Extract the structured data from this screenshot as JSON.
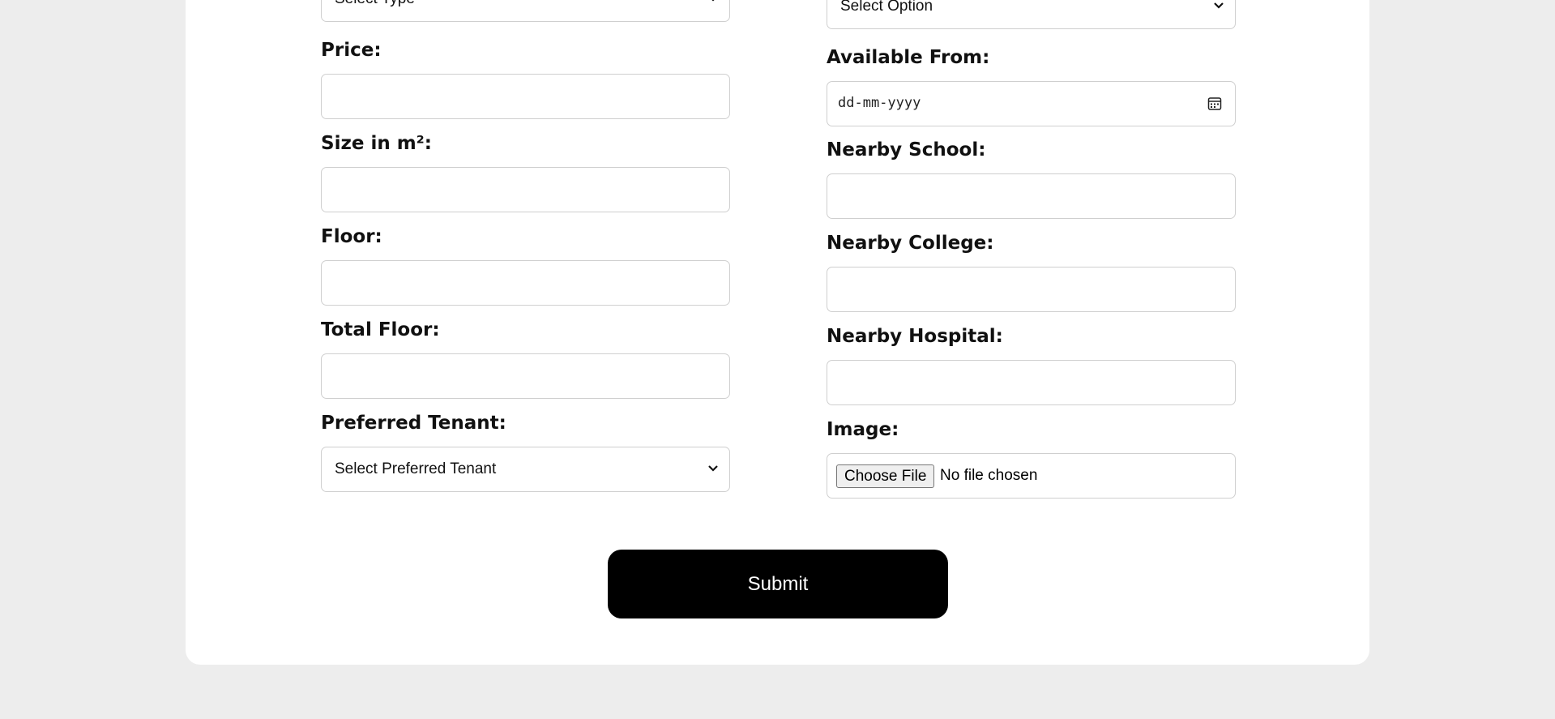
{
  "left_column": {
    "type_select": "Select Type",
    "price_label": "Price:",
    "size_label": "Size in m²:",
    "floor_label": "Floor:",
    "total_floor_label": "Total Floor:",
    "preferred_tenant_label": "Preferred Tenant:",
    "preferred_tenant_select": "Select Preferred Tenant"
  },
  "right_column": {
    "option_select": "Select Option",
    "available_from_label": "Available From:",
    "date_placeholder": "dd-mm-yyyy",
    "nearby_school_label": "Nearby School:",
    "nearby_college_label": "Nearby College:",
    "nearby_hospital_label": "Nearby Hospital:",
    "image_label": "Image:",
    "file_button": "Choose File",
    "file_status": "No file chosen"
  },
  "submit_label": "Submit",
  "icons": [
    "chevron-down-icon",
    "calendar-icon"
  ]
}
